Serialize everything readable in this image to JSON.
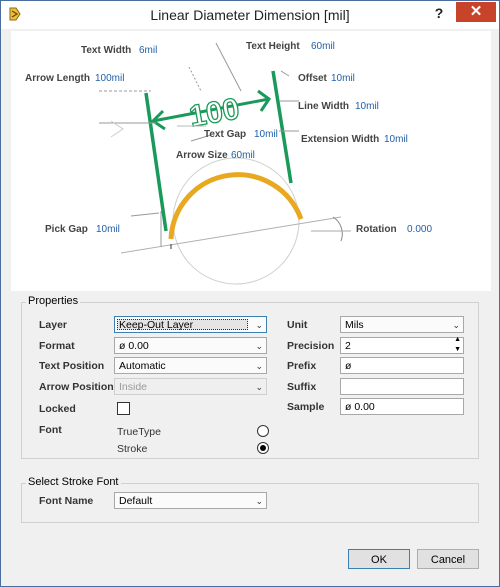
{
  "window": {
    "title": "Linear Diameter Dimension [mil]",
    "help_label": "?",
    "close_label": "✕"
  },
  "diagram": {
    "sample_text": "100",
    "labels": [
      {
        "label": "Text Width",
        "value": "6mil"
      },
      {
        "label": "Text Height",
        "value": "60mil"
      },
      {
        "label": "Arrow Length",
        "value": "100mil"
      },
      {
        "label": "Offset",
        "value": "10mil"
      },
      {
        "label": "Line Width",
        "value": "10mil"
      },
      {
        "label": "Text Gap",
        "value": "10mil"
      },
      {
        "label": "Extension Width",
        "value": "10mil"
      },
      {
        "label": "Arrow Size",
        "value": "60mil"
      },
      {
        "label": "Pick Gap",
        "value": "10mil"
      },
      {
        "label": "Rotation",
        "value": "0.000"
      }
    ]
  },
  "properties": {
    "title": "Properties",
    "layer": {
      "label": "Layer",
      "value": "Keep-Out Layer"
    },
    "format": {
      "label": "Format",
      "value": "ø 0.00"
    },
    "text_position": {
      "label": "Text Position",
      "value": "Automatic"
    },
    "arrow_position": {
      "label": "Arrow Position",
      "value": "Inside"
    },
    "locked": {
      "label": "Locked",
      "checked": false
    },
    "font": {
      "label": "Font",
      "options": [
        "TrueType",
        "Stroke"
      ],
      "selected": "Stroke"
    },
    "unit": {
      "label": "Unit",
      "value": "Mils"
    },
    "precision": {
      "label": "Precision",
      "value": "2"
    },
    "prefix": {
      "label": "Prefix",
      "value": "ø"
    },
    "suffix": {
      "label": "Suffix",
      "value": ""
    },
    "sample": {
      "label": "Sample",
      "value": "ø 0.00"
    }
  },
  "stroke_font": {
    "title": "Select Stroke Font",
    "font_name": {
      "label": "Font Name",
      "value": "Default"
    }
  },
  "buttons": {
    "ok": "OK",
    "cancel": "Cancel"
  },
  "colors": {
    "dimension_green": "#1a9a5a",
    "arc_orange": "#f0b020",
    "value_blue": "#1f5fa8",
    "close_red": "#c7432a"
  }
}
